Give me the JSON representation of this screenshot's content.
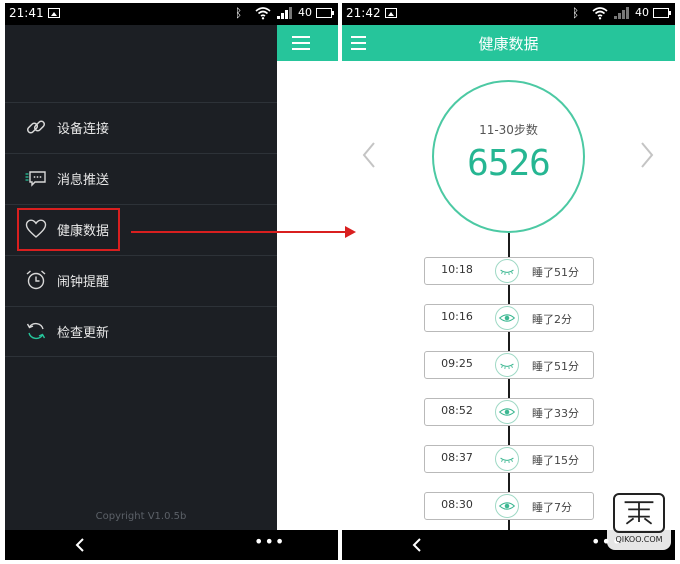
{
  "left_phone": {
    "status": {
      "time": "21:41",
      "battery": "40"
    },
    "menu": [
      {
        "label": "设备连接",
        "icon": "link-icon"
      },
      {
        "label": "消息推送",
        "icon": "message-icon"
      },
      {
        "label": "健康数据",
        "icon": "heart-icon"
      },
      {
        "label": "闹钟提醒",
        "icon": "alarm-clock-icon"
      },
      {
        "label": "检查更新",
        "icon": "refresh-icon"
      }
    ],
    "copyright": "Copyright V1.0.5b"
  },
  "right_phone": {
    "status": {
      "time": "21:42",
      "battery": "40"
    },
    "title": "健康数据",
    "steps": {
      "label": "11-30步数",
      "value": "6526"
    },
    "sleep_records": [
      {
        "time": "10:18",
        "duration": "睡了51分",
        "state": "closed-eye"
      },
      {
        "time": "10:16",
        "duration": "睡了2分",
        "state": "open-eye"
      },
      {
        "time": "09:25",
        "duration": "睡了51分",
        "state": "closed-eye"
      },
      {
        "time": "08:52",
        "duration": "睡了33分",
        "state": "open-eye"
      },
      {
        "time": "08:37",
        "duration": "睡了15分",
        "state": "closed-eye"
      },
      {
        "time": "08:30",
        "duration": "睡了7分",
        "state": "open-eye"
      }
    ]
  },
  "watermark": {
    "text": "QIKOO.COM"
  },
  "colors": {
    "accent": "#26c59b",
    "drawer": "#1c1f24",
    "highlight": "#d91f1f"
  }
}
